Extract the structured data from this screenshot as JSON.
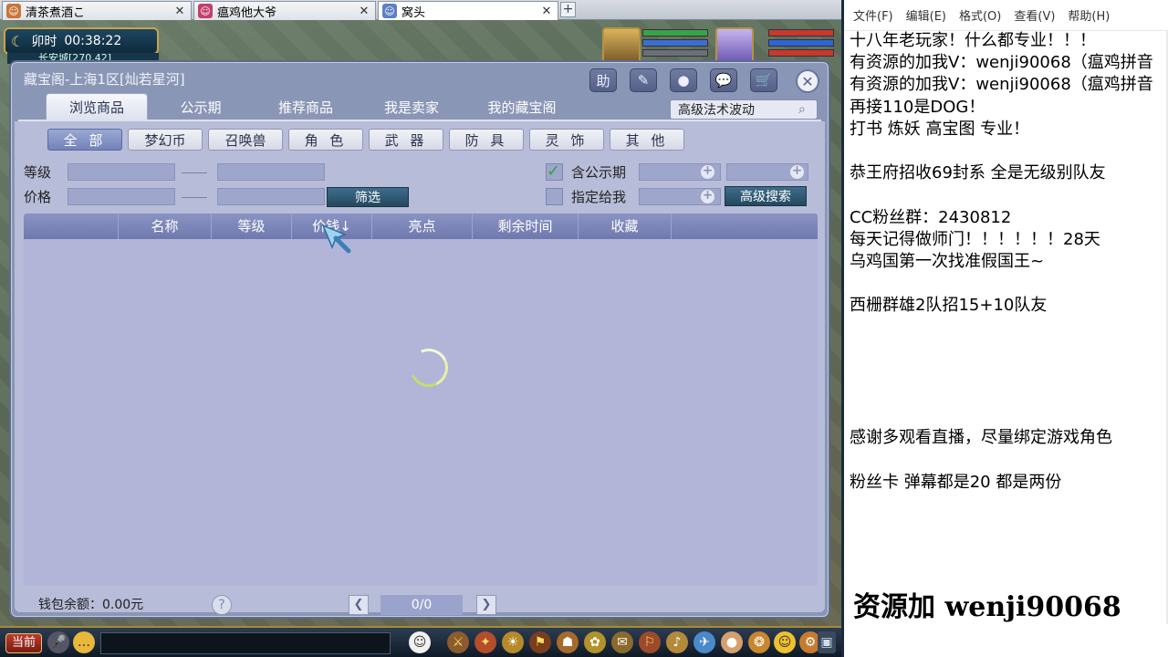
{
  "browser_tabs": [
    {
      "label": "清茶煮酒こ",
      "active": false
    },
    {
      "label": "瘟鸡他大爷",
      "active": false
    },
    {
      "label": "窝头",
      "active": true
    }
  ],
  "game": {
    "time_period": "卯时",
    "clock": "00:38:22",
    "location": "长安城[270,42]",
    "bottom_button": "当前"
  },
  "dialog": {
    "title": "藏宝阁-上海1区[灿若星河]",
    "tabs": [
      "浏览商品",
      "公示期",
      "推荐商品",
      "我是卖家",
      "我的藏宝阁"
    ],
    "search_value": "高级法术波动",
    "categories": [
      "全 部",
      "梦幻币",
      "召唤兽",
      "角 色",
      "武 器",
      "防 具",
      "灵 饰",
      "其 他"
    ],
    "filter": {
      "level_label": "等级",
      "price_label": "价格",
      "filter_button": "筛选",
      "include_public_label": "含公示期",
      "include_public_checked": true,
      "assigned_to_me_label": "指定给我",
      "assigned_to_me_checked": false,
      "advanced_search_button": "高级搜索"
    },
    "table_headers": [
      "名称",
      "等级",
      "价钱↓",
      "亮点",
      "剩余时间",
      "收藏"
    ],
    "wallet": "钱包余额：0.00元",
    "help": "?",
    "page": "0/0",
    "tool_buttons": [
      "助",
      "✎",
      "●",
      "💬",
      "🛒"
    ]
  },
  "notepad": {
    "menu": [
      "文件(F)",
      "编辑(E)",
      "格式(O)",
      "查看(V)",
      "帮助(H)"
    ],
    "lines": [
      "十八年老玩家！什么都专业！！！",
      "有资源的加我V：wenji90068（瘟鸡拼音",
      "有资源的加我V：wenji90068（瘟鸡拼音",
      "再接110是DOG！",
      "打书 炼妖 高宝图 专业！",
      "",
      "恭王府招收69封系 全是无级别队友",
      "",
      "CC粉丝群：2430812",
      "每天记得做师门！！！！！！28天",
      "乌鸡国第一次找准假国王~",
      "",
      "西栅群雄2队招15+10队友",
      "",
      "",
      "",
      "",
      "",
      "感谢多观看直播，尽量绑定游戏角色",
      "",
      "粉丝卡 弹幕都是20 都是两份"
    ],
    "banner": "资源加 wenji90068"
  },
  "colors": {
    "dialog_bg": "#8a96b6",
    "panel_bg": "#b7bcd8",
    "header_bg": "#7a84b8",
    "filter_button": "#2f5a75"
  }
}
